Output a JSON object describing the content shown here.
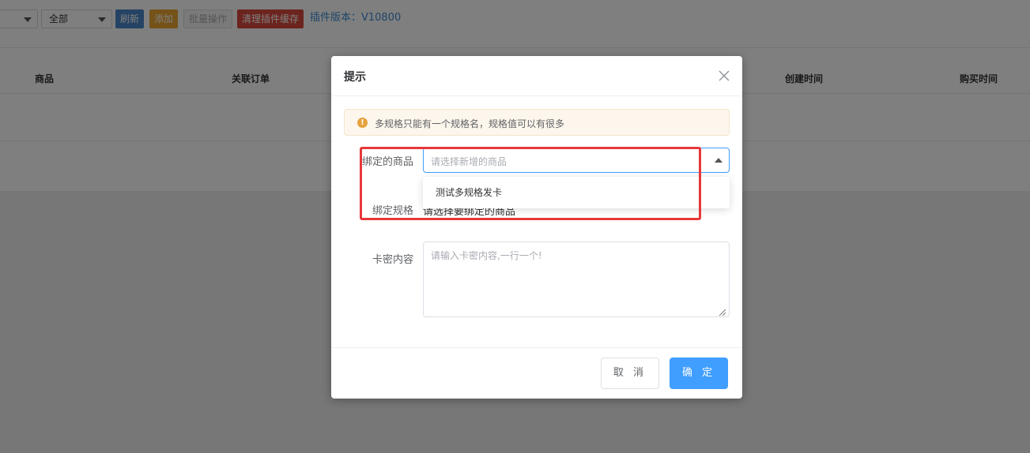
{
  "toolbar": {
    "select_2_value": "全部",
    "refresh_label": "刷新",
    "add_label": "添加",
    "batch_label": "批量操作",
    "clear_cache_label": "清理插件缓存",
    "version_text": "插件版本：V10800"
  },
  "table": {
    "columns": [
      "商品",
      "关联订单",
      "创建时间",
      "购买时间"
    ]
  },
  "dialog": {
    "title": "提示",
    "alert_text": "多规格只能有一个规格名，规格值可以有很多",
    "product_label": "绑定的商品",
    "product_placeholder": "请选择新增的商品",
    "product_options": [
      "测试多规格发卡"
    ],
    "spec_label": "绑定规格",
    "spec_text": "请选择要绑定的商品",
    "card_label": "卡密内容",
    "card_placeholder": "请输入卡密内容,一行一个!",
    "cancel_label": "取 消",
    "confirm_label": "确 定"
  },
  "colors": {
    "primary": "#409eff",
    "warning": "#e6a23c",
    "annotation": "#e8373a",
    "refresh_btn": "#4a87c8",
    "add_btn": "#e8a531",
    "clear_btn": "#d8493c"
  }
}
